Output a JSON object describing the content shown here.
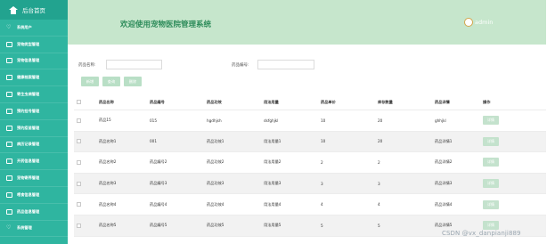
{
  "sidebar": {
    "title": "后台首页",
    "items": [
      {
        "icon": "heart-icon",
        "label": "系统用户"
      },
      {
        "icon": "box-icon",
        "label": "宠物类型管理"
      },
      {
        "icon": "box-icon",
        "label": "宠物信息管理"
      },
      {
        "icon": "box-icon",
        "label": "健康档案管理"
      },
      {
        "icon": "box-icon",
        "label": "寄生虫病管理"
      },
      {
        "icon": "box-icon",
        "label": "预约挂号管理"
      },
      {
        "icon": "box-icon",
        "label": "预约疫苗管理"
      },
      {
        "icon": "box-icon",
        "label": "病历记录管理"
      },
      {
        "icon": "box-icon",
        "label": "开药信息管理"
      },
      {
        "icon": "box-icon",
        "label": "宠物寄养管理"
      },
      {
        "icon": "box-icon",
        "label": "喂食信息管理"
      },
      {
        "icon": "box-icon",
        "label": "药品信息管理"
      },
      {
        "icon": "heart-icon",
        "label": "系统管理"
      }
    ]
  },
  "header": {
    "welcome": "欢迎使用宠物医院管理系统",
    "username": "admin"
  },
  "search": {
    "name_label": "药品名称:",
    "code_label": "药品编号:",
    "name_value": "",
    "code_value": ""
  },
  "buttons": {
    "add": "新增",
    "search": "查询",
    "delete": "删除"
  },
  "table": {
    "headers": [
      "药品名称",
      "药品编号",
      "药品功效",
      "用法用量",
      "药品单价",
      "库存数量",
      "药品详情",
      "操作"
    ],
    "rows": [
      [
        "药品15",
        "015",
        "hgdhjsh",
        "dsfghjkl",
        "10",
        "20",
        "ghhjkl",
        "详情"
      ],
      [
        "药品名称1",
        "001",
        "药品功效1",
        "用法用量1",
        "10",
        "20",
        "药品详情1",
        "详情"
      ],
      [
        "药品名称2",
        "药品编号2",
        "药品功效2",
        "用法用量2",
        "2",
        "2",
        "药品详情2",
        "详情"
      ],
      [
        "药品名称3",
        "药品编号3",
        "药品功效3",
        "用法用量3",
        "3",
        "3",
        "药品详情3",
        "详情"
      ],
      [
        "药品名称4",
        "药品编号4",
        "药品功效4",
        "用法用量4",
        "4",
        "4",
        "药品详情4",
        "详情"
      ],
      [
        "药品名称5",
        "药品编号5",
        "药品功效5",
        "用法用量5",
        "5",
        "5",
        "药品详情5",
        "详情"
      ]
    ]
  },
  "watermark": "CSDN @vx_danpianji889",
  "colors": {
    "sidebar": "#2fb5a0",
    "header": "#c6e6cc",
    "accent": "#2d8c5a",
    "button": "#b9dfc6"
  }
}
